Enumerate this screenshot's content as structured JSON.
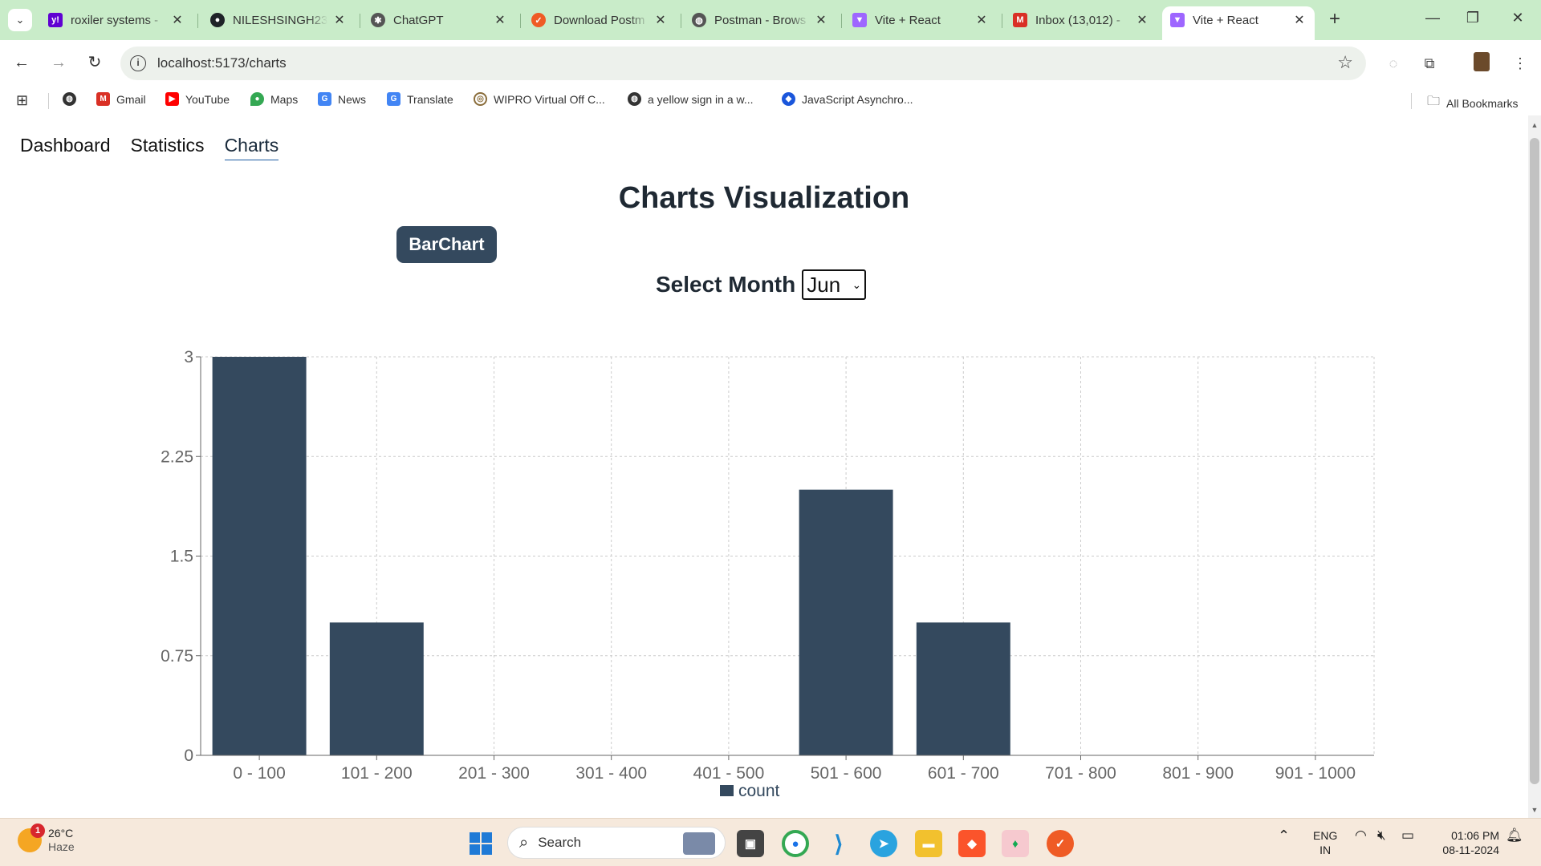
{
  "browser": {
    "tabs": [
      {
        "title": "roxiler systems -",
        "favicon_color": "#6001d2",
        "favicon_glyph": "y!"
      },
      {
        "title": "NILESHSINGH23",
        "favicon_color": "#1f2328",
        "favicon_glyph": "⬤"
      },
      {
        "title": "ChatGPT",
        "favicon_color": "#555555",
        "favicon_glyph": "✱"
      },
      {
        "title": "Download Postm",
        "favicon_color": "#ef5b25",
        "favicon_glyph": "✓"
      },
      {
        "title": "Postman - Brows",
        "favicon_color": "#555555",
        "favicon_glyph": "◍"
      },
      {
        "title": "Vite + React",
        "favicon_color": "#9e66ff",
        "favicon_glyph": "▼"
      },
      {
        "title": "Inbox (13,012) -",
        "favicon_color": "#d93025",
        "favicon_glyph": "M"
      },
      {
        "title": "Vite + React",
        "favicon_color": "#9e66ff",
        "favicon_glyph": "▼"
      }
    ],
    "url": "localhost:5173/charts",
    "bookmarks": [
      {
        "label": "Gmail",
        "color": "#d93025",
        "glyph": "M"
      },
      {
        "label": "YouTube",
        "color": "#ff0000",
        "glyph": "▶"
      },
      {
        "label": "Maps",
        "color": "#34a853",
        "glyph": "◆"
      },
      {
        "label": "News",
        "color": "#4285f4",
        "glyph": "G"
      },
      {
        "label": "Translate",
        "color": "#4285f4",
        "glyph": "G"
      },
      {
        "label": "WIPRO Virtual Off C...",
        "color": "#8a6d3b",
        "glyph": "◎"
      },
      {
        "label": "a yellow sign in a w...",
        "color": "#333333",
        "glyph": "◍"
      },
      {
        "label": "JavaScript Asynchro...",
        "color": "#1a56db",
        "glyph": "◆"
      }
    ],
    "all_bookmarks": "All Bookmarks"
  },
  "nav": {
    "links": [
      "Dashboard",
      "Statistics",
      "Charts"
    ],
    "active": "Charts"
  },
  "page": {
    "title": "Charts Visualization",
    "chart_button": "BarChart",
    "month_label": "Select Month",
    "month_value": "Jun"
  },
  "chart_data": {
    "type": "bar",
    "categories": [
      "0 - 100",
      "101 - 200",
      "201 - 300",
      "301 - 400",
      "401 - 500",
      "501 - 600",
      "601 - 700",
      "701 - 800",
      "801 - 900",
      "901 - 1000"
    ],
    "series": [
      {
        "name": "count",
        "values": [
          3,
          1,
          0,
          0,
          0,
          2,
          1,
          0,
          0,
          0
        ]
      }
    ],
    "y_ticks": [
      "0",
      "0.75",
      "1.5",
      "2.25",
      "3"
    ],
    "ylim": [
      0,
      3
    ],
    "bar_color": "#34495e",
    "grid": "dashed",
    "legend": "bottom-center"
  },
  "taskbar": {
    "weather_temp": "26°C",
    "weather_desc": "Haze",
    "weather_badge": "1",
    "search_placeholder": "Search",
    "lang_top": "ENG",
    "lang_bottom": "IN",
    "time": "01:06 PM",
    "date": "08-11-2024"
  }
}
